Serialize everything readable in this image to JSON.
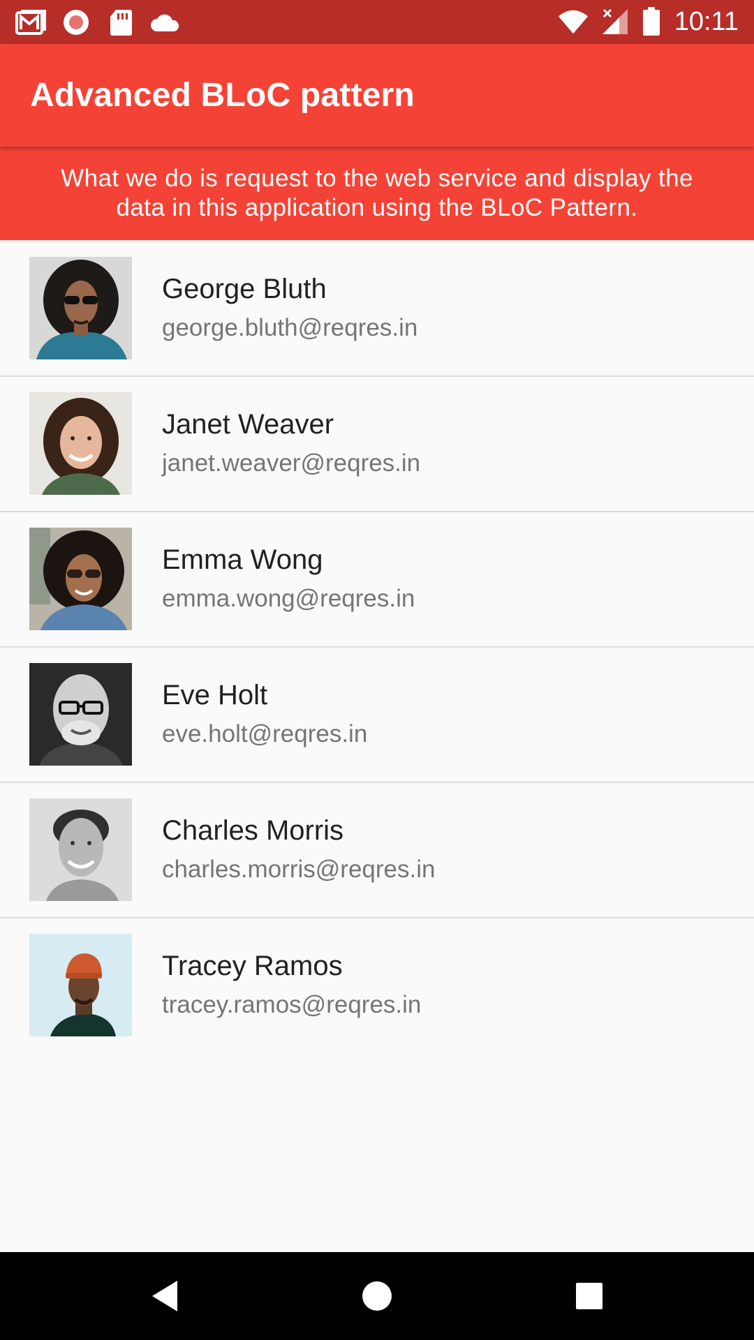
{
  "status_bar": {
    "time": "10:11",
    "left_icons": [
      "gmail-icon",
      "record-icon",
      "sd-card-icon",
      "cloud-icon"
    ],
    "right_icons": [
      "wifi-icon",
      "signal-icon",
      "battery-icon"
    ]
  },
  "app_bar": {
    "title": "Advanced BLoC pattern",
    "color": "#f44336"
  },
  "banner": {
    "text": "What we do is request to the web service and display the data in this application using the BLoC Pattern."
  },
  "users": [
    {
      "name": "George Bluth",
      "email": "george.bluth@reqres.in",
      "avatar": "avatar-george-bluth"
    },
    {
      "name": "Janet Weaver",
      "email": "janet.weaver@reqres.in",
      "avatar": "avatar-janet-weaver"
    },
    {
      "name": "Emma Wong",
      "email": "emma.wong@reqres.in",
      "avatar": "avatar-emma-wong"
    },
    {
      "name": "Eve Holt",
      "email": "eve.holt@reqres.in",
      "avatar": "avatar-eve-holt"
    },
    {
      "name": "Charles Morris",
      "email": "charles.morris@reqres.in",
      "avatar": "avatar-charles-morris"
    },
    {
      "name": "Tracey Ramos",
      "email": "tracey.ramos@reqres.in",
      "avatar": "avatar-tracey-ramos"
    }
  ],
  "nav_bar": {
    "buttons": [
      "back-icon",
      "home-icon",
      "recents-icon"
    ]
  }
}
